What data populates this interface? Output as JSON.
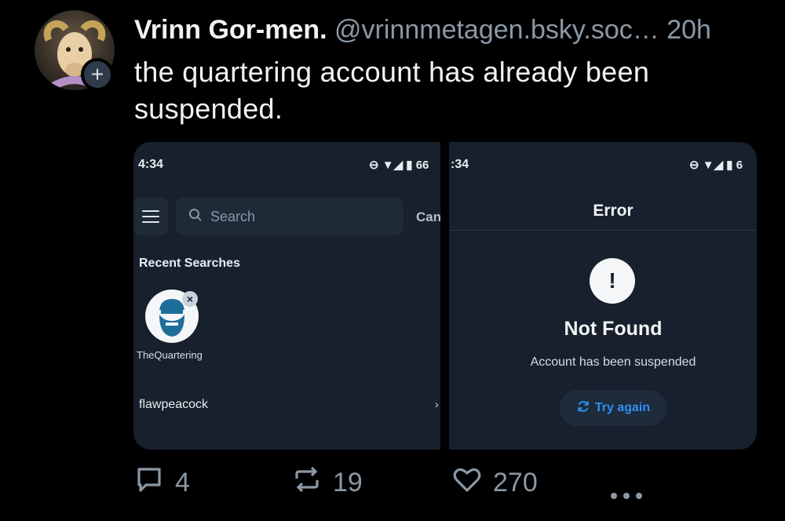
{
  "post": {
    "author_name": "Vrinn Gor-men.",
    "handle": "@vrinnmetagen.bsky.soc…",
    "time": "20h",
    "text": "the quartering account has already been suspended.",
    "follow_symbol": "+"
  },
  "screenshot_left": {
    "status_time": "4:34",
    "status_icons": "⊖ ▼◢ ▮ 66",
    "search_placeholder": "Search",
    "cancel_label": "Can",
    "recent_title": "Recent Searches",
    "recent_account": "TheQuartering",
    "recent_row": "flawpeacock",
    "chevron": "›"
  },
  "screenshot_right": {
    "status_time": ":34",
    "status_icons": "⊖ ▼◢ ▮ 6",
    "nav_title": "Error",
    "error_symbol": "!",
    "heading": "Not Found",
    "message": "Account has been suspended",
    "retry_label": "Try again"
  },
  "actions": {
    "reply_count": "4",
    "repost_count": "19",
    "like_count": "270"
  },
  "colors": {
    "background": "#000000",
    "muted": "#8b98a5",
    "accent_blue": "#2f8ff0",
    "panel": "#17202c"
  }
}
